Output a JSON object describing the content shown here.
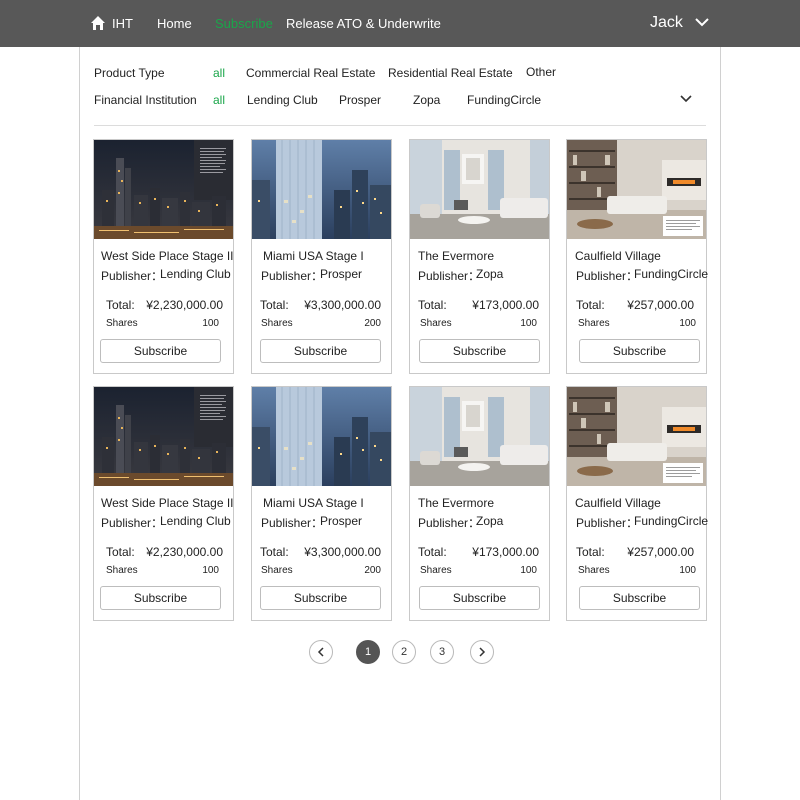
{
  "nav": {
    "brand": "IHT",
    "links": [
      "Home",
      "Subscribe",
      "Release ATO & Underwrite"
    ],
    "active_link": "Subscribe",
    "user": "Jack",
    "home_icon": "home-icon",
    "user_menu_icon": "chevron-down-icon"
  },
  "filters": {
    "product_type": {
      "label": "Product Type",
      "options": [
        "all",
        "Commercial Real Estate",
        "Residential Real Estate",
        "Other"
      ],
      "selected": "all"
    },
    "financial_institution": {
      "label": "Financial Institution",
      "options": [
        "all",
        "Lending Club",
        "Prosper",
        "Zopa",
        "FundingCircle"
      ],
      "selected": "all"
    },
    "expand_icon": "chevron-down-icon"
  },
  "cards": [
    {
      "title": "West Side Place Stage II",
      "publisher_label": "Publisher：",
      "publisher": "Lending Club",
      "total_label": "Total:",
      "total": "¥2,230,000.00",
      "shares_label": "Shares",
      "shares": "100",
      "button": "Subscribe",
      "image": "night-city-skyline"
    },
    {
      "title": "Miami USA Stage I",
      "publisher_label": "Publisher：",
      "publisher": "Prosper",
      "total_label": "Total:",
      "total": "¥3,300,000.00",
      "shares_label": "Shares",
      "shares": "200",
      "button": "Subscribe",
      "image": "glass-tower-dusk"
    },
    {
      "title": "The Evermore",
      "publisher_label": "Publisher：",
      "publisher": "Zopa",
      "total_label": "Total:",
      "total": "¥173,000.00",
      "shares_label": "Shares",
      "shares": "100",
      "button": "Subscribe",
      "image": "bright-living-room"
    },
    {
      "title": "Caulfield Village",
      "publisher_label": "Publisher：",
      "publisher": "FundingCircle",
      "total_label": "Total:",
      "total": "¥257,000.00",
      "shares_label": "Shares",
      "shares": "100",
      "button": "Subscribe",
      "image": "lounge-fireplace"
    },
    {
      "title": "West Side Place Stage II",
      "publisher_label": "Publisher：",
      "publisher": "Lending Club",
      "total_label": "Total:",
      "total": "¥2,230,000.00",
      "shares_label": "Shares",
      "shares": "100",
      "button": "Subscribe",
      "image": "night-city-skyline"
    },
    {
      "title": "Miami USA Stage I",
      "publisher_label": "Publisher：",
      "publisher": "Prosper",
      "total_label": "Total:",
      "total": "¥3,300,000.00",
      "shares_label": "Shares",
      "shares": "200",
      "button": "Subscribe",
      "image": "glass-tower-dusk"
    },
    {
      "title": "The Evermore",
      "publisher_label": "Publisher：",
      "publisher": "Zopa",
      "total_label": "Total:",
      "total": "¥173,000.00",
      "shares_label": "Shares",
      "shares": "100",
      "button": "Subscribe",
      "image": "bright-living-room"
    },
    {
      "title": "Caulfield Village",
      "publisher_label": "Publisher：",
      "publisher": "FundingCircle",
      "total_label": "Total:",
      "total": "¥257,000.00",
      "shares_label": "Shares",
      "shares": "100",
      "button": "Subscribe",
      "image": "lounge-fireplace"
    }
  ],
  "pagination": {
    "pages": [
      "1",
      "2",
      "3"
    ],
    "current": "1",
    "prev_icon": "chevron-left-icon",
    "next_icon": "chevron-right-icon"
  },
  "colors": {
    "topbar": "#585858",
    "accent_green": "#1aa64a",
    "pagination_active": "#555555"
  }
}
